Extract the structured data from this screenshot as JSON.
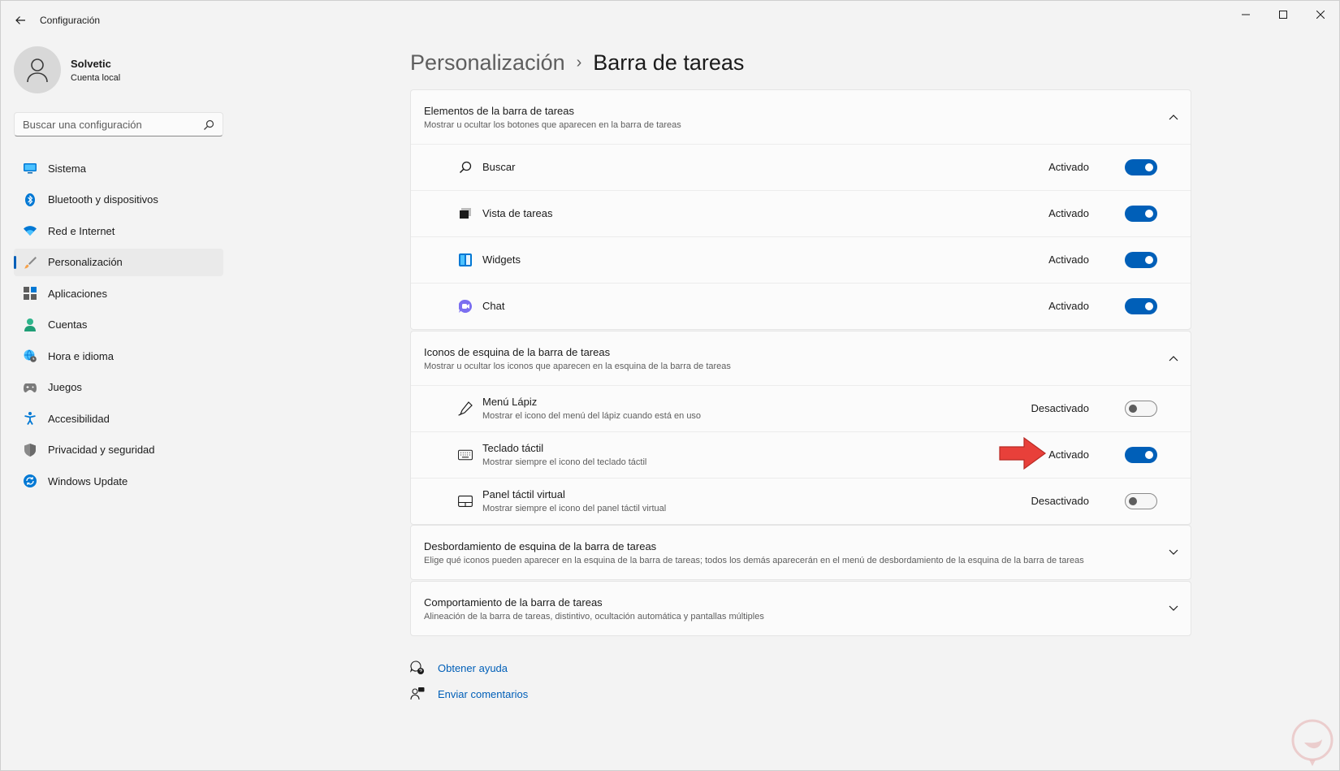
{
  "app": {
    "title": "Configuración"
  },
  "profile": {
    "name": "Solvetic",
    "account": "Cuenta local"
  },
  "search": {
    "placeholder": "Buscar una configuración"
  },
  "sidebar": {
    "items": [
      {
        "label": "Sistema",
        "icon": "monitor-icon"
      },
      {
        "label": "Bluetooth y dispositivos",
        "icon": "bluetooth-icon"
      },
      {
        "label": "Red e Internet",
        "icon": "wifi-icon"
      },
      {
        "label": "Personalización",
        "icon": "brush-icon",
        "active": true
      },
      {
        "label": "Aplicaciones",
        "icon": "apps-icon"
      },
      {
        "label": "Cuentas",
        "icon": "person-icon"
      },
      {
        "label": "Hora e idioma",
        "icon": "globe-clock-icon"
      },
      {
        "label": "Juegos",
        "icon": "gamepad-icon"
      },
      {
        "label": "Accesibilidad",
        "icon": "accessibility-icon"
      },
      {
        "label": "Privacidad y seguridad",
        "icon": "shield-icon"
      },
      {
        "label": "Windows Update",
        "icon": "update-icon"
      }
    ]
  },
  "breadcrumb": {
    "parent": "Personalización",
    "separator": "›",
    "current": "Barra de tareas"
  },
  "sections": {
    "taskbar_items": {
      "title": "Elementos de la barra de tareas",
      "subtitle": "Mostrar u ocultar los botones que aparecen en la barra de tareas",
      "expanded": true,
      "rows": [
        {
          "label": "Buscar",
          "state": "Activado",
          "on": true,
          "icon": "search-icon"
        },
        {
          "label": "Vista de tareas",
          "state": "Activado",
          "on": true,
          "icon": "task-view-icon"
        },
        {
          "label": "Widgets",
          "state": "Activado",
          "on": true,
          "icon": "widgets-icon"
        },
        {
          "label": "Chat",
          "state": "Activado",
          "on": true,
          "icon": "chat-icon"
        }
      ]
    },
    "corner_icons": {
      "title": "Iconos de esquina de la barra de tareas",
      "subtitle": "Mostrar u ocultar los iconos que aparecen en la esquina de la barra de tareas",
      "expanded": true,
      "rows": [
        {
          "label": "Menú Lápiz",
          "desc": "Mostrar el icono del menú del lápiz cuando está en uso",
          "state": "Desactivado",
          "on": false,
          "icon": "pen-icon"
        },
        {
          "label": "Teclado táctil",
          "desc": "Mostrar siempre el icono del teclado táctil",
          "state": "Activado",
          "on": true,
          "icon": "keyboard-icon"
        },
        {
          "label": "Panel táctil virtual",
          "desc": "Mostrar siempre el icono del panel táctil virtual",
          "state": "Desactivado",
          "on": false,
          "icon": "touchpad-icon"
        }
      ]
    },
    "corner_overflow": {
      "title": "Desbordamiento de esquina de la barra de tareas",
      "subtitle": "Elige qué iconos pueden aparecer en la esquina de la barra de tareas; todos los demás aparecerán en el menú de desbordamiento de la esquina de la barra de tareas",
      "expanded": false
    },
    "behaviors": {
      "title": "Comportamiento de la barra de tareas",
      "subtitle": "Alineación de la barra de tareas, distintivo, ocultación automática y pantallas múltiples",
      "expanded": false
    }
  },
  "links": {
    "help": "Obtener ayuda",
    "feedback": "Enviar comentarios"
  },
  "colors": {
    "accent": "#005fb8",
    "annotation_arrow": "#e8403a"
  }
}
